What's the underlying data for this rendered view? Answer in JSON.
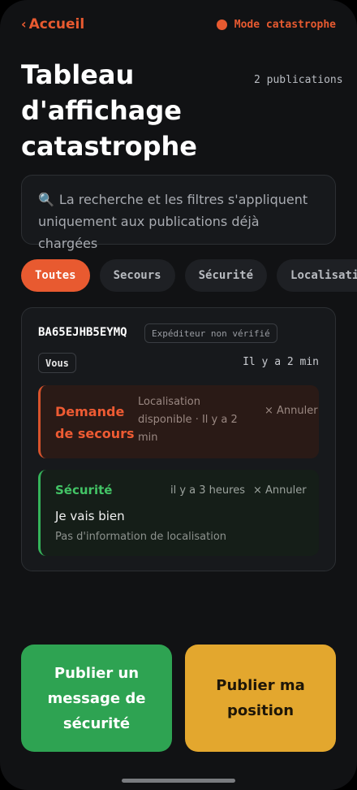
{
  "nav": {
    "back_label": "Accueil",
    "mode_label": "Mode catastrophe"
  },
  "header": {
    "title": "Tableau d'affichage catastrophe",
    "count": "2 publications"
  },
  "notice": {
    "text": "La recherche et les filtres s'appliquent uniquement aux publications déjà chargées",
    "icon": "search-icon"
  },
  "filters": [
    {
      "label": "Toutes",
      "active": true
    },
    {
      "label": "Secours",
      "active": false
    },
    {
      "label": "Sécurité",
      "active": false
    },
    {
      "label": "Localisation",
      "active": false
    }
  ],
  "card": {
    "sender_id": "BA65EJHB5EYMQ",
    "unverified_label": "Expéditeur non vérifié",
    "you_label": "Vous",
    "time": "Il y a 2 min",
    "posts": [
      {
        "kind": "Demande de secours",
        "location": "Localisation disponible · Il y a 2 min",
        "cancel": "× Annuler"
      },
      {
        "kind": "Sécurité",
        "time": "il y a 3 heures",
        "cancel": "× Annuler",
        "message": "Je vais bien",
        "location": "Pas d'information de localisation"
      }
    ]
  },
  "actions": {
    "safety_button": "Publier un message de sécurité",
    "position_button": "Publier ma position"
  },
  "colors": {
    "accent": "#e85a30",
    "green": "#2ea352",
    "yellow": "#e3a72e",
    "background": "#111214"
  }
}
